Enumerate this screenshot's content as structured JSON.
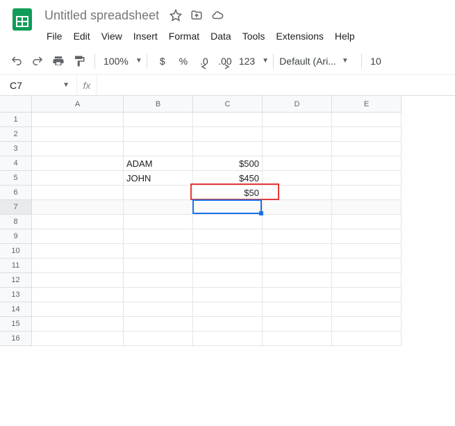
{
  "doc_title": "Untitled spreadsheet",
  "menu": {
    "file": "File",
    "edit": "Edit",
    "view": "View",
    "insert": "Insert",
    "format": "Format",
    "data": "Data",
    "tools": "Tools",
    "extensions": "Extensions",
    "help": "Help"
  },
  "toolbar": {
    "zoom": "100%",
    "currency": "$",
    "percent": "%",
    "dec_dec": ".0",
    "dec_inc": ".00",
    "num_fmt": "123",
    "font": "Default (Ari...",
    "font_size": "10"
  },
  "name_box": "C7",
  "fx_label": "fx",
  "formula": "",
  "columns": [
    "A",
    "B",
    "C",
    "D",
    "E"
  ],
  "row_count": 16,
  "cells": {
    "B4": "ADAM",
    "C4": "$500",
    "B5": "JOHN",
    "C5": "$450",
    "C6": "$50"
  },
  "selection": {
    "cell": "C7"
  },
  "highlight": {
    "cell": "C6"
  }
}
